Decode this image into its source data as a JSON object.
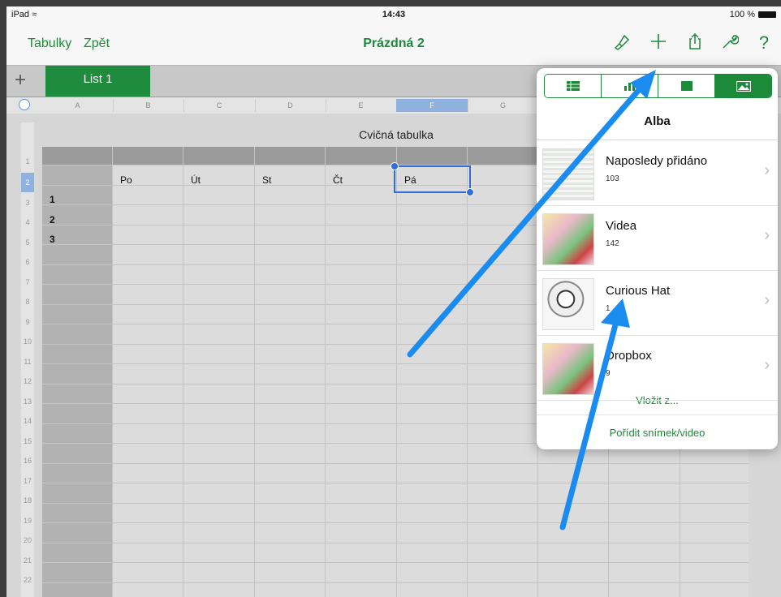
{
  "status_bar": {
    "device": "iPad",
    "time": "14:43",
    "battery": "100 %"
  },
  "toolbar": {
    "spreadsheets_label": "Tabulky",
    "back_label": "Zpět",
    "document_title": "Prázdná 2",
    "icons": [
      "format-brush-icon",
      "plus-icon",
      "share-icon",
      "wrench-icon",
      "help-icon"
    ],
    "help_glyph": "?"
  },
  "sheets": {
    "add_glyph": "+",
    "active_tab": "List 1"
  },
  "columns": [
    "A",
    "B",
    "C",
    "D",
    "E",
    "F",
    "G"
  ],
  "selected_column": "F",
  "rows": [
    "1",
    "2",
    "3",
    "4",
    "5",
    "6",
    "7",
    "8",
    "9",
    "10",
    "11",
    "12",
    "13",
    "14",
    "15",
    "16",
    "17",
    "18",
    "19",
    "20",
    "21",
    "22"
  ],
  "selected_row": "2",
  "table": {
    "title": "Cvičná tabulka",
    "header_cells": [
      "Po",
      "Út",
      "St",
      "Čt",
      "Pá"
    ],
    "row_labels": [
      "1",
      "2",
      "3"
    ]
  },
  "popover": {
    "segments": [
      "table-icon",
      "chart-icon",
      "shape-icon",
      "image-icon"
    ],
    "active_segment": 3,
    "heading": "Alba",
    "albums": [
      {
        "name": "Naposledy přidáno",
        "count": "103"
      },
      {
        "name": "Videa",
        "count": "142"
      },
      {
        "name": "Curious Hat",
        "count": "1"
      },
      {
        "name": "Dropbox",
        "count": "9"
      }
    ],
    "insert_from": "Vložit z...",
    "take_photo": "Pořídit snímek/video"
  },
  "colors": {
    "accent": "#1d8a3a",
    "selection": "#2f6ed6",
    "arrow": "#1a8cf0"
  }
}
